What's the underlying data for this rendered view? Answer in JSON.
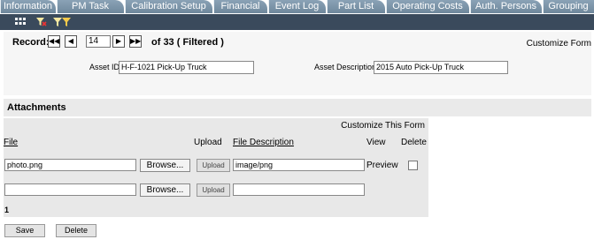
{
  "tabs": [
    "Information",
    "PM Task",
    "Calibration Setup",
    "Financial",
    "Event Log",
    "Part List",
    "Operating Costs",
    "Auth. Persons",
    "Grouping"
  ],
  "toolbar": {
    "icons": [
      "grid-icon",
      "filter-clear-icon",
      "filter-icon",
      "filter-run-icon"
    ]
  },
  "record": {
    "label": "Record:",
    "current": "14",
    "of_text": "of 33 ( Filtered )",
    "customize_form": "Customize Form"
  },
  "asset": {
    "id_label": "Asset ID",
    "id_value": "H-F-1021 Pick-Up Truck",
    "desc_label": "Asset Description",
    "desc_value": "2015 Auto Pick-Up Truck"
  },
  "attachments": {
    "title": "Attachments",
    "customize_this_form": "Customize This Form",
    "headers": {
      "file": "File",
      "upload": "Upload",
      "file_description": "File Description",
      "view": "View",
      "delete": "Delete"
    },
    "rows": [
      {
        "file": "photo.png",
        "browse": "Browse...",
        "upload": "Upload",
        "description": "image/png",
        "view": "Preview"
      },
      {
        "file": "",
        "browse": "Browse...",
        "upload": "Upload",
        "description": "",
        "view": ""
      }
    ],
    "page": "1"
  },
  "buttons": {
    "save": "Save",
    "delete": "Delete"
  }
}
